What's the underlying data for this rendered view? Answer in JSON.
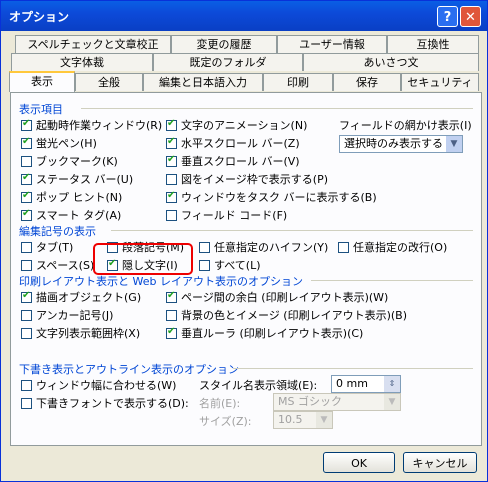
{
  "window": {
    "title": "オプション",
    "help_glyph": "?",
    "close_glyph": "✕"
  },
  "tabs": {
    "row1": [
      "スペルチェックと文章校正",
      "変更の履歴",
      "ユーザー情報",
      "互換性"
    ],
    "row2": [
      "文字体裁",
      "既定のフォルダ",
      "あいさつ文"
    ],
    "row3": [
      "表示",
      "全般",
      "編集と日本語入力",
      "印刷",
      "保存",
      "セキュリティ"
    ],
    "active": "表示"
  },
  "display": {
    "heading": "表示項目",
    "col1": [
      {
        "label": "起動時作業ウィンドウ(R)",
        "checked": true
      },
      {
        "label": "蛍光ペン(H)",
        "checked": true
      },
      {
        "label": "ブックマーク(K)",
        "checked": false
      },
      {
        "label": "ステータス バー(U)",
        "checked": true
      },
      {
        "label": "ポップ ヒント(N)",
        "checked": true
      },
      {
        "label": "スマート タグ(A)",
        "checked": true
      }
    ],
    "col2": [
      {
        "label": "文字のアニメーション(N)",
        "checked": true
      },
      {
        "label": "水平スクロール バー(Z)",
        "checked": true
      },
      {
        "label": "垂直スクロール バー(V)",
        "checked": true
      },
      {
        "label": "図をイメージ枠で表示する(P)",
        "checked": false
      },
      {
        "label": "ウィンドウをタスク バーに表示する(B)",
        "checked": true
      },
      {
        "label": "フィールド コード(F)",
        "checked": false
      }
    ],
    "shading_label": "フィールドの網かけ表示(I)",
    "shading_value": "選択時のみ表示する"
  },
  "formatting": {
    "heading": "編集記号の表示",
    "row1": [
      {
        "label": "タブ(T)",
        "checked": false
      },
      {
        "label": "段落記号(M)",
        "checked": false
      },
      {
        "label": "任意指定のハイフン(Y)",
        "checked": false
      },
      {
        "label": "任意指定の改行(O)",
        "checked": false
      }
    ],
    "row2": [
      {
        "label": "スペース(S)",
        "checked": false
      },
      {
        "label": "隠し文字(I)",
        "checked": true
      },
      {
        "label": "すべて(L)",
        "checked": false
      }
    ]
  },
  "print_layout": {
    "heading": "印刷レイアウト表示と Web レイアウト表示のオプション",
    "col1": [
      {
        "label": "描画オブジェクト(G)",
        "checked": true
      },
      {
        "label": "アンカー記号(J)",
        "checked": false
      },
      {
        "label": "文字列表示範囲枠(X)",
        "checked": false
      }
    ],
    "col2": [
      {
        "label": "ページ間の余白 (印刷レイアウト表示)(W)",
        "checked": true
      },
      {
        "label": "背景の色とイメージ (印刷レイアウト表示)(B)",
        "checked": false
      },
      {
        "label": "垂直ルーラ (印刷レイアウト表示)(C)",
        "checked": true
      }
    ]
  },
  "outline": {
    "heading": "下書き表示とアウトライン表示のオプション",
    "col1": [
      {
        "label": "ウィンドウ幅に合わせる(W)",
        "checked": false
      },
      {
        "label": "下書きフォントで表示する(D):",
        "checked": false
      }
    ],
    "style_label": "スタイル名表示領域(E):",
    "style_value": "0 mm",
    "font_name_label": "名前(E):",
    "font_name_value": "MS ゴシック",
    "font_size_label": "サイズ(Z):",
    "font_size_value": "10.5"
  },
  "buttons": {
    "ok": "OK",
    "cancel": "キャンセル"
  }
}
